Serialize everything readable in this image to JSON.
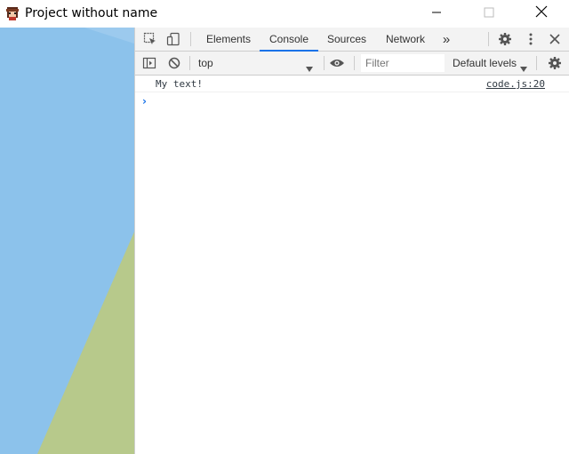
{
  "window": {
    "title": "Project without name",
    "icon": "pixel-character-icon"
  },
  "colors": {
    "sky": "#8cc2eb",
    "ground": "#b7c98b",
    "accent": "#1a73e8"
  },
  "devtools": {
    "tabs": [
      {
        "label": "Elements",
        "active": false
      },
      {
        "label": "Console",
        "active": true
      },
      {
        "label": "Sources",
        "active": false
      },
      {
        "label": "Network",
        "active": false
      }
    ],
    "more_tabs": "»",
    "context": "top",
    "filter_placeholder": "Filter",
    "levels": "Default levels"
  },
  "console": {
    "messages": [
      {
        "text": "My text!",
        "source": "code.js:20"
      }
    ],
    "prompt": "›"
  }
}
